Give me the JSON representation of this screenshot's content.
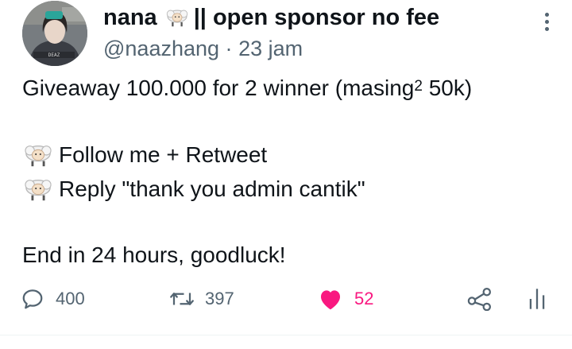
{
  "author": {
    "display_name": "nana",
    "name_suffix": "|| open sponsor no fee",
    "handle": "@naazhang",
    "separator": "·",
    "time": "23 jam",
    "avatar_caption": "DEAZ"
  },
  "tweet": {
    "line1": "Giveaway 100.000 for 2 winner (masing",
    "line1_sup": "2",
    "line1_tail": " 50k)",
    "line2": "Follow me + Retweet",
    "line3": "Reply \"thank you admin cantik\"",
    "line4": "End in 24 hours, goodluck!"
  },
  "actions": {
    "reply_count": "400",
    "retweet_count": "397",
    "like_count": "52",
    "like_color": "#f91880"
  },
  "icons": {
    "name_emoji": "sheep-icon",
    "bullet_emoji": "sheep-icon",
    "reply": "reply-icon",
    "retweet": "retweet-icon",
    "like": "heart-filled-icon",
    "share": "share-icon",
    "analytics": "analytics-icon",
    "more": "more-vertical-icon"
  }
}
